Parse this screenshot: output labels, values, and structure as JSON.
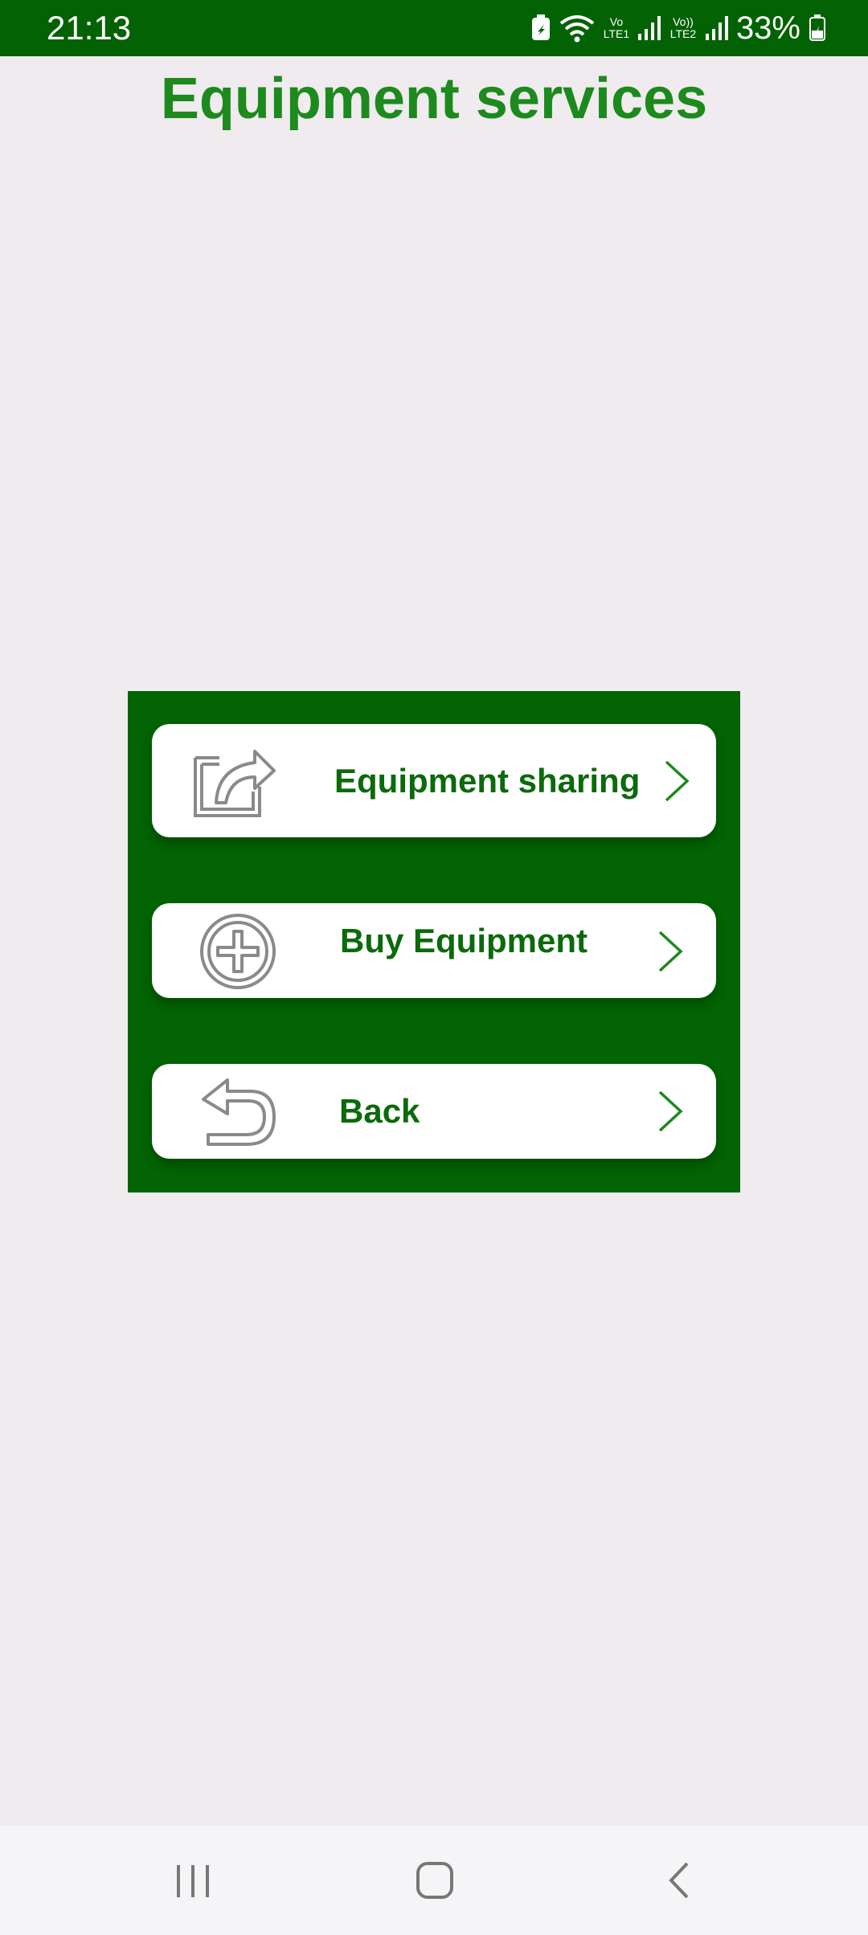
{
  "status_bar": {
    "time": "21:13",
    "battery": "33%",
    "network_1": "Vo LTE1",
    "network_2": "Vo)) LTE2",
    "background_color": "#036203"
  },
  "page": {
    "title": "Equipment services",
    "title_color": "#1c8a1c",
    "panel_color": "#026402"
  },
  "menu": [
    {
      "label": "Equipment sharing",
      "icon": "share-icon"
    },
    {
      "label": "Buy Equipment",
      "icon": "plus-circle-icon"
    },
    {
      "label": "Back",
      "icon": "undo-arrow-icon"
    }
  ],
  "nav_bar": {
    "buttons": [
      "recent-apps-icon",
      "home-icon",
      "back-icon"
    ]
  }
}
